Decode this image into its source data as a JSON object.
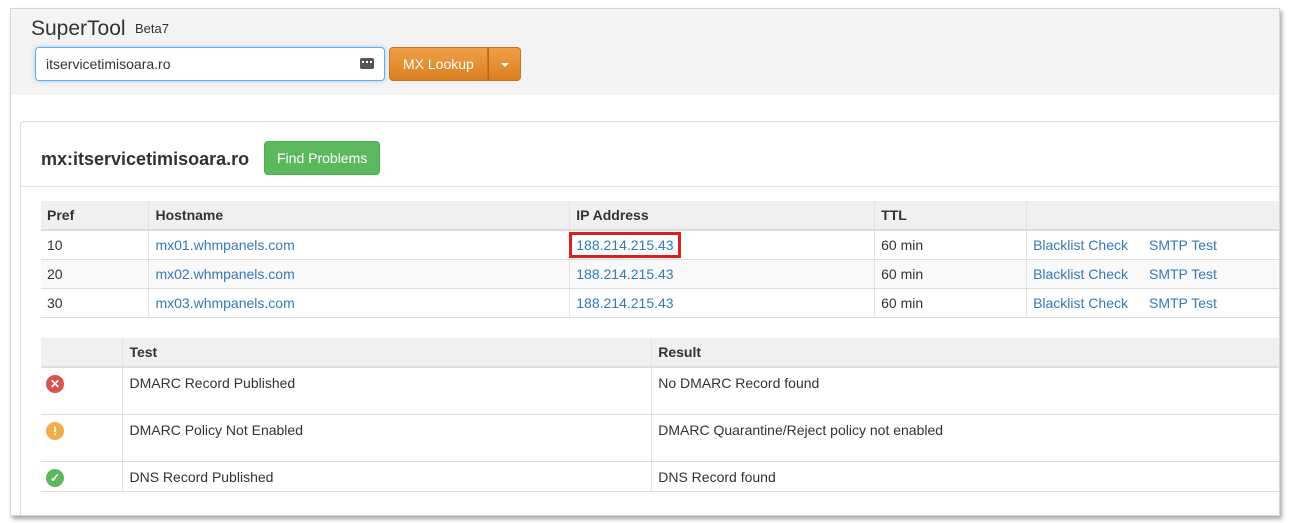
{
  "app": {
    "title": "SuperTool",
    "version": "Beta7"
  },
  "search": {
    "value": "itservicetimisoara.ro",
    "placeholder": ""
  },
  "toolbar": {
    "lookup_label": "MX Lookup"
  },
  "panel": {
    "title": "mx:itservicetimisoara.ro",
    "find_problems_label": "Find Problems"
  },
  "mx_table": {
    "headers": [
      "Pref",
      "Hostname",
      "IP Address",
      "TTL",
      ""
    ],
    "rows": [
      {
        "pref": "10",
        "hostname": "mx01.whmpanels.com",
        "ip": "188.214.215.43",
        "ttl": "60 min",
        "blacklist": "Blacklist Check",
        "smtp": "SMTP Test"
      },
      {
        "pref": "20",
        "hostname": "mx02.whmpanels.com",
        "ip": "188.214.215.43",
        "ttl": "60 min",
        "blacklist": "Blacklist Check",
        "smtp": "SMTP Test"
      },
      {
        "pref": "30",
        "hostname": "mx03.whmpanels.com",
        "ip": "188.214.215.43",
        "ttl": "60 min",
        "blacklist": "Blacklist Check",
        "smtp": "SMTP Test"
      }
    ]
  },
  "test_table": {
    "headers": [
      "",
      "Test",
      "Result"
    ],
    "rows": [
      {
        "status": "error",
        "icon": "x-circle-icon",
        "test": "DMARC Record Published",
        "result": "No DMARC Record found"
      },
      {
        "status": "warning",
        "icon": "exclamation-circle-icon",
        "test": "DMARC Policy Not Enabled",
        "result": "DMARC Quarantine/Reject policy not enabled"
      },
      {
        "status": "ok",
        "icon": "check-circle-icon",
        "test": "DNS Record Published",
        "result": "DNS Record found"
      }
    ]
  },
  "colors": {
    "lookup_button": "#e08a30",
    "find_button": "#5cb85c",
    "link": "#337ab7",
    "highlight_box": "#d9201a"
  }
}
